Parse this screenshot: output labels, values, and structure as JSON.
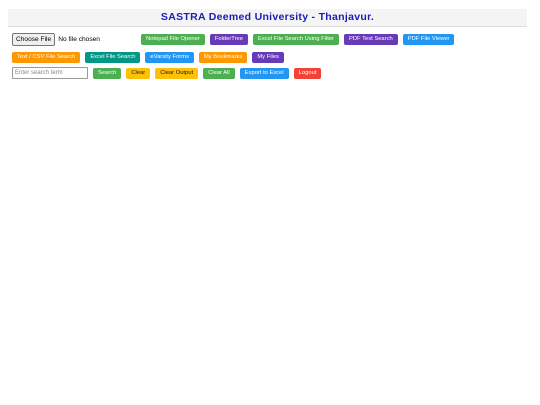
{
  "header": {
    "title": "SASTRA Deemed University - Thanjavur."
  },
  "file_input": {
    "button_label": "Choose File",
    "status_text": "No file chosen"
  },
  "toolbar1": [
    {
      "label": "Notepad File Opener",
      "color": "#4caf50"
    },
    {
      "label": "FolderTree",
      "color": "#673ab7"
    },
    {
      "label": "Excel File Search Using Filter",
      "color": "#4caf50"
    },
    {
      "label": "PDF Text Search",
      "color": "#673ab7"
    },
    {
      "label": "PDF File Viewer",
      "color": "#2196f3"
    }
  ],
  "toolbar2": [
    {
      "label": "Text / CSV File Search",
      "color": "#ff9800"
    },
    {
      "label": "Excel File Search",
      "color": "#009688"
    },
    {
      "label": "eVarsity Forms",
      "color": "#2196f3"
    },
    {
      "label": "My Bookmarks",
      "color": "#ff9800"
    },
    {
      "label": "My Files",
      "color": "#673ab7"
    }
  ],
  "search": {
    "placeholder": "Enter search term"
  },
  "toolbar3": [
    {
      "label": "Search",
      "color": "#4caf50"
    },
    {
      "label": "Clear",
      "color": "#ffc107"
    },
    {
      "label": "Clear Output",
      "color": "#ffc107"
    },
    {
      "label": "Clear All",
      "color": "#4caf50"
    },
    {
      "label": "Export to Excel",
      "color": "#2196f3"
    },
    {
      "label": "Logout",
      "color": "#f44336"
    }
  ]
}
